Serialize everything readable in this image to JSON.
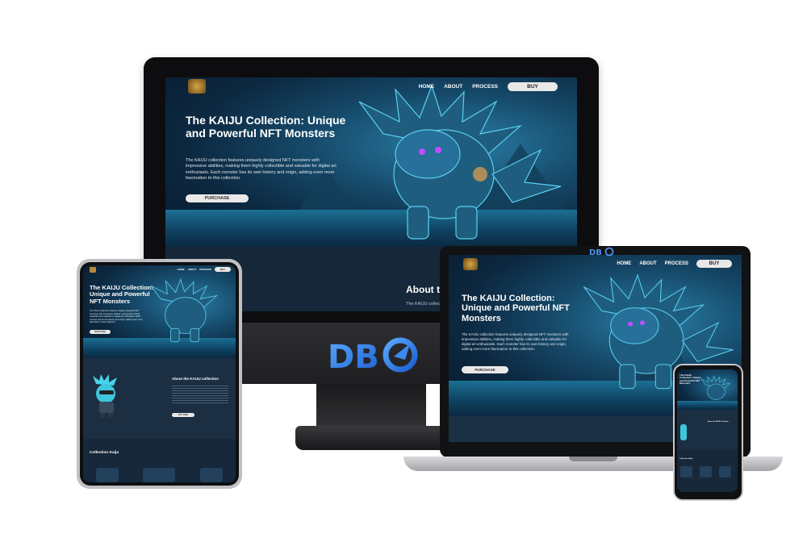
{
  "brand": {
    "logo_text": "KAIJU",
    "watermark": "DB"
  },
  "nav": {
    "home": "HOME",
    "about": "ABOUT",
    "process": "PROCESS",
    "buy": "BUY"
  },
  "hero": {
    "title": "The KAIJU Collection: Unique and Powerful NFT Monsters",
    "description": "The KAIJU collection features uniquely designed NFT monsters with impressive abilities, making them highly collectible and valuable for digital art enthusiasts. Each monster has its own history and origin, adding even more fascination to this collection.",
    "button": "PURCHASE"
  },
  "about": {
    "title_partial": "About t",
    "desc_partial": "The KAIJU collec",
    "title": "About the KAIJU collection",
    "button": "BUY NOW"
  },
  "collection": {
    "title": "Collection Kaiju"
  },
  "colors": {
    "accent": "#2a7fa8",
    "dark": "#16283a",
    "button": "#e9e9e9"
  }
}
